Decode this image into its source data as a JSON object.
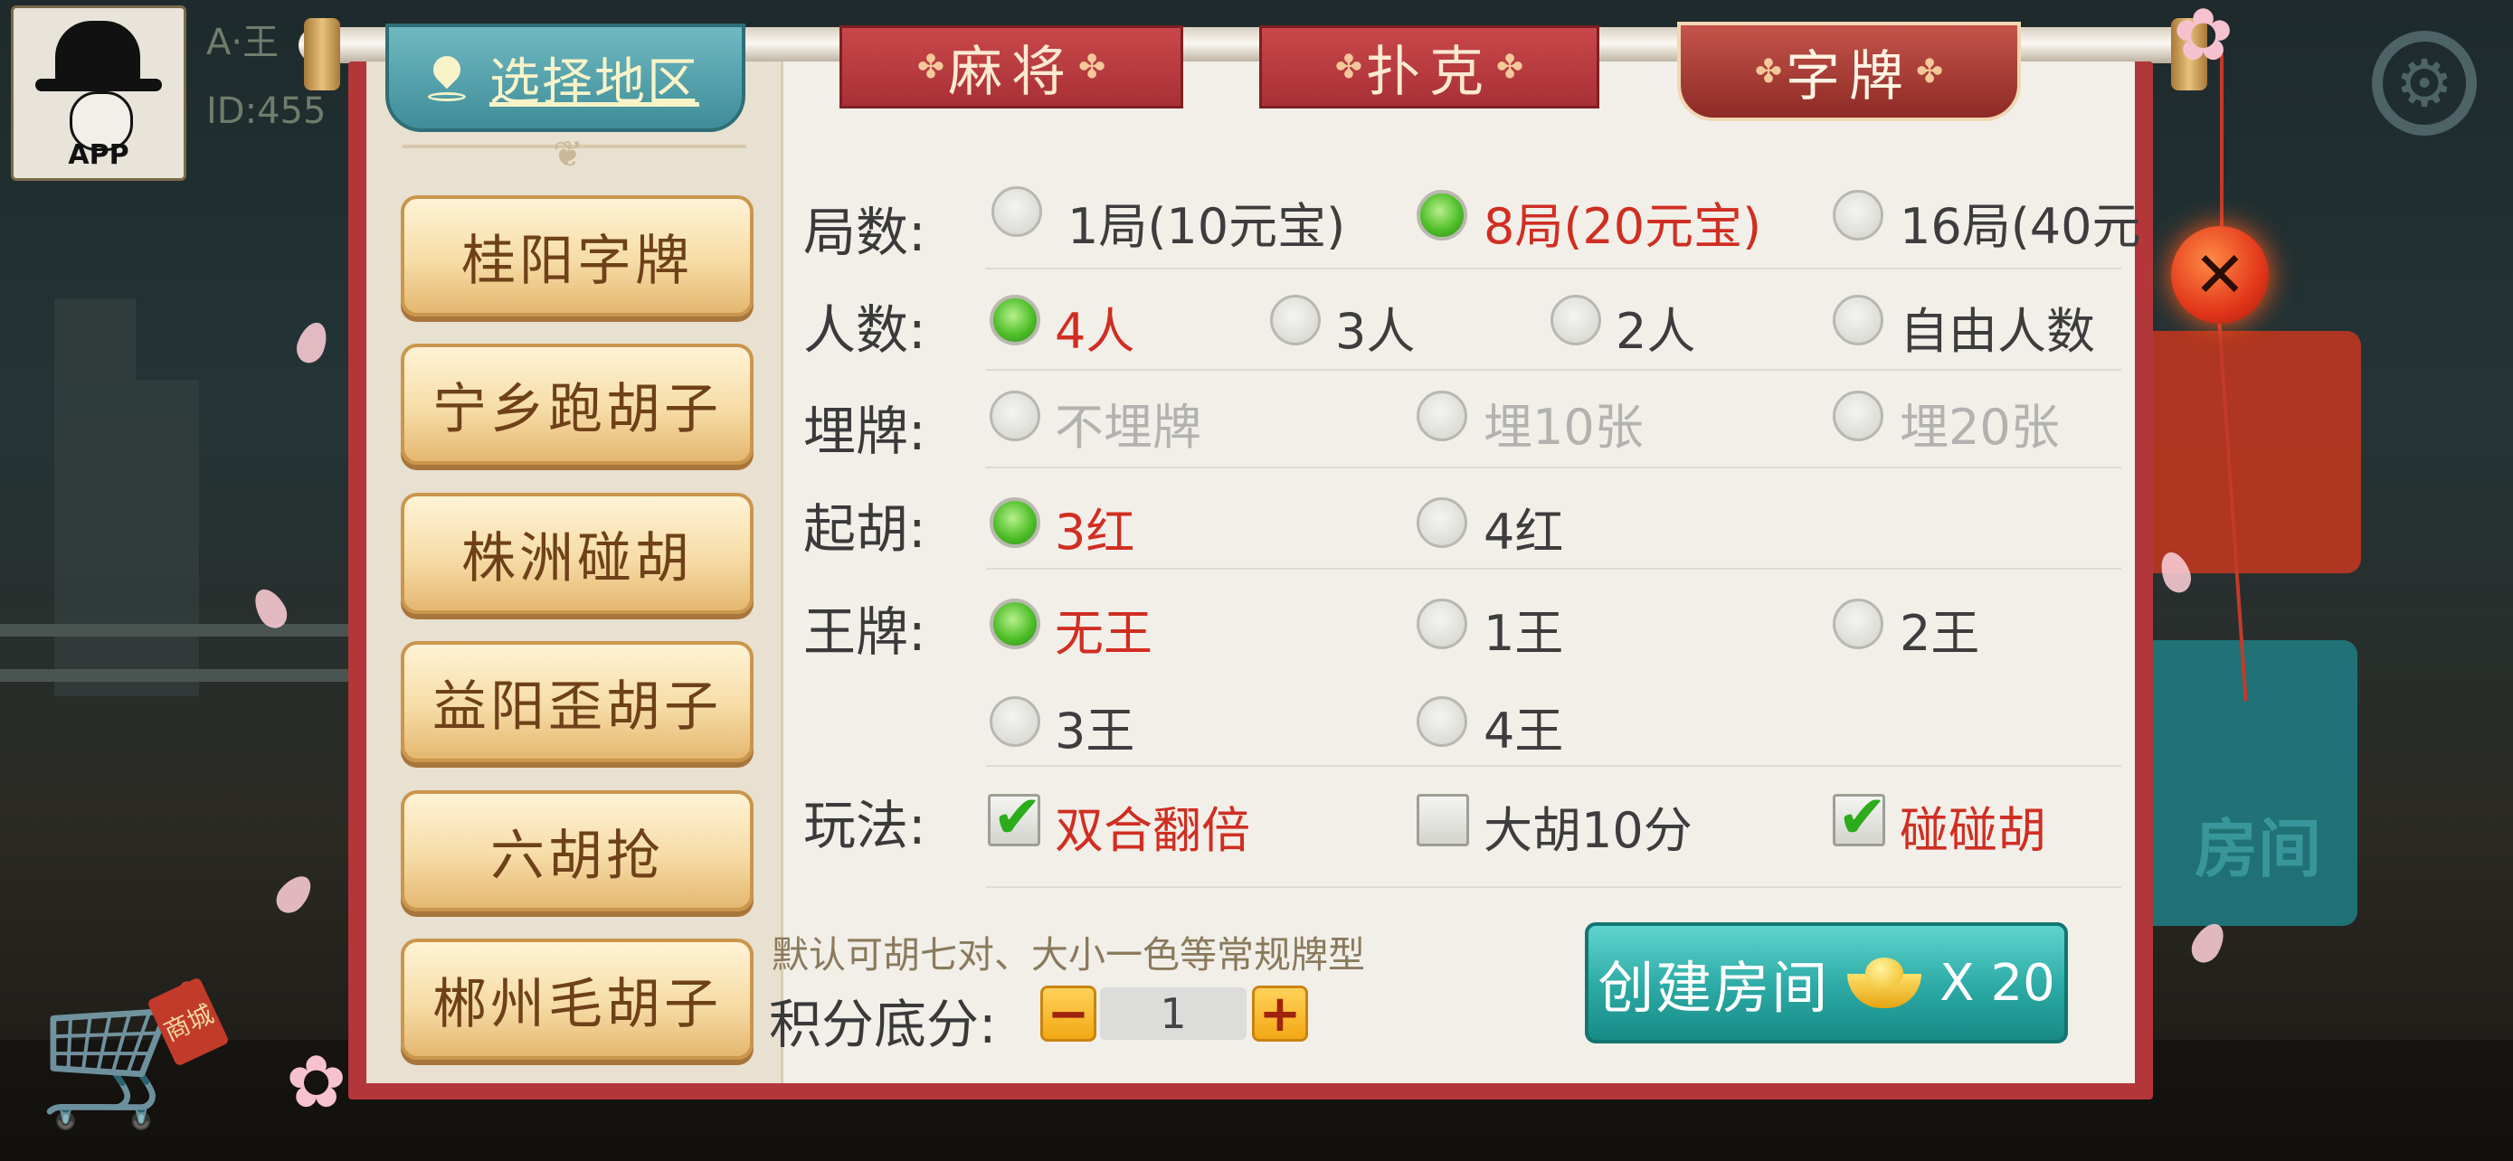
{
  "player": {
    "avatar_text": "APP",
    "name_partial": "A·王",
    "id_partial": "ID:455"
  },
  "background": {
    "shop_tag": "商城",
    "room_text": "房间"
  },
  "header": {
    "region_label": "选择地区",
    "tabs": [
      {
        "label": "麻将",
        "active": false
      },
      {
        "label": "扑克",
        "active": false
      },
      {
        "label": "字牌",
        "active": true
      }
    ],
    "ornament": "✤"
  },
  "sidebar": {
    "items": [
      {
        "label": "桂阳字牌"
      },
      {
        "label": "宁乡跑胡子"
      },
      {
        "label": "株洲碰胡"
      },
      {
        "label": "益阳歪胡子"
      },
      {
        "label": "六胡抢"
      },
      {
        "label": "郴州毛胡子"
      }
    ]
  },
  "options": {
    "rounds": {
      "label": "局数:",
      "choices": [
        {
          "label": "1局(10元宝)",
          "selected": false
        },
        {
          "label": "8局(20元宝)",
          "selected": true
        },
        {
          "label": "16局(40元",
          "selected": false
        }
      ]
    },
    "players": {
      "label": "人数:",
      "choices": [
        {
          "label": "4人",
          "selected": true
        },
        {
          "label": "3人",
          "selected": false
        },
        {
          "label": "2人",
          "selected": false
        },
        {
          "label": "自由人数",
          "selected": false
        }
      ]
    },
    "bury": {
      "label": "埋牌:",
      "choices": [
        {
          "label": "不埋牌",
          "selected": false,
          "disabled": true
        },
        {
          "label": "埋10张",
          "selected": false,
          "disabled": true
        },
        {
          "label": "埋20张",
          "selected": false,
          "disabled": true
        }
      ]
    },
    "qihu": {
      "label": "起胡:",
      "choices": [
        {
          "label": "3红",
          "selected": true
        },
        {
          "label": "4红",
          "selected": false
        }
      ]
    },
    "king": {
      "label": "王牌:",
      "choices": [
        {
          "label": "无王",
          "selected": true
        },
        {
          "label": "1王",
          "selected": false
        },
        {
          "label": "2王",
          "selected": false
        },
        {
          "label": "3王",
          "selected": false
        },
        {
          "label": "4王",
          "selected": false
        }
      ]
    },
    "rules": {
      "label": "玩法:",
      "choices": [
        {
          "label": "双合翻倍",
          "checked": true
        },
        {
          "label": "大胡10分",
          "checked": false
        },
        {
          "label": "碰碰胡",
          "checked": true
        }
      ]
    }
  },
  "footer": {
    "note": "默认可胡七对、大小一色等常规牌型",
    "score_label": "积分底分:",
    "score_value": "1",
    "minus": "−",
    "plus": "+",
    "create_label": "创建房间",
    "create_cost": "X 20"
  },
  "colors": {
    "selected_text": "#d02e22",
    "radio_on": "#4fbf2a",
    "create_button": "#2ba9a4",
    "dialog_frame": "#b3363a"
  }
}
